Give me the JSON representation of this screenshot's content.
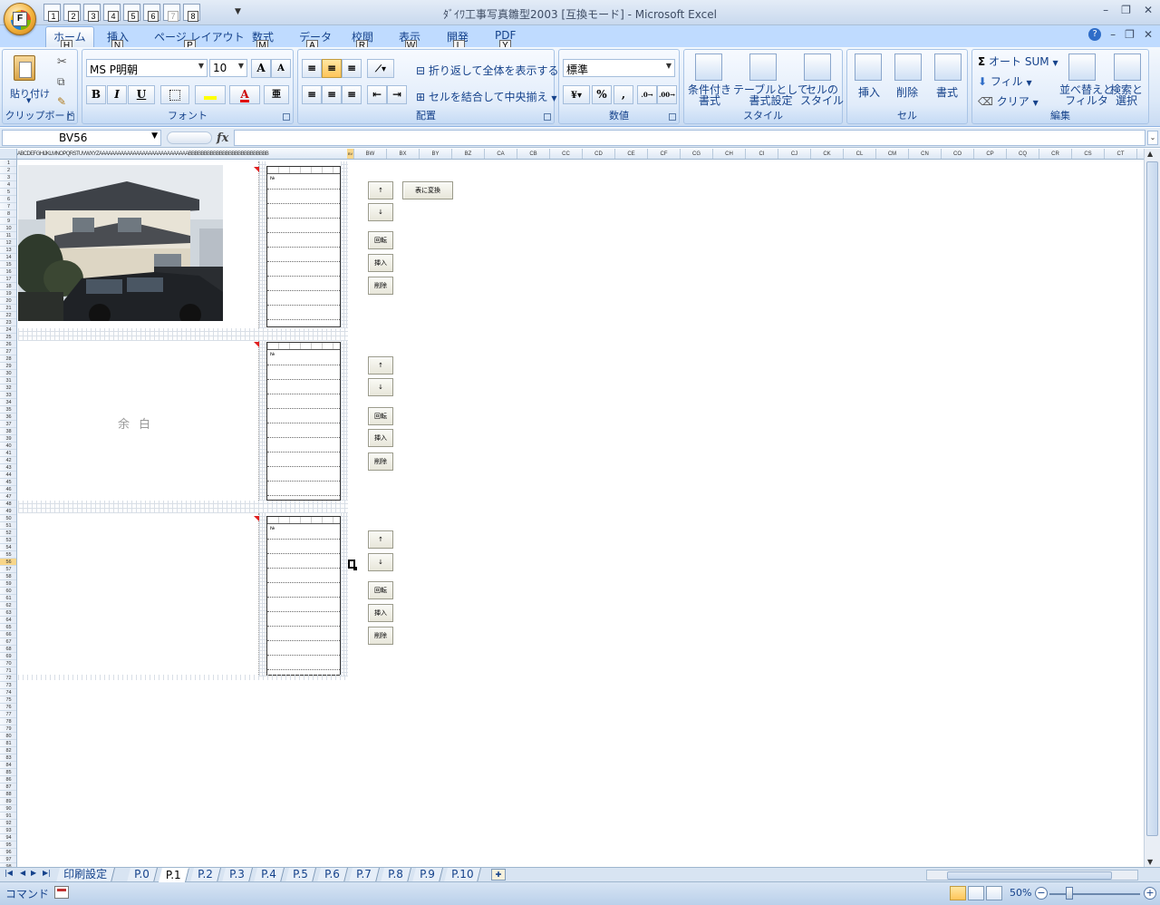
{
  "window": {
    "title": "ﾀﾞｲﾜ工事写真雛型2003 [互換モード] - Microsoft Excel",
    "office_key": "F",
    "qat_keys": [
      "1",
      "2",
      "3",
      "4",
      "5",
      "6",
      "7",
      "8"
    ],
    "controls": {
      "minimize": "–",
      "restore": "❐",
      "close": "✕"
    }
  },
  "ribbon_tabs": [
    {
      "label": "ホーム",
      "key": "H"
    },
    {
      "label": "挿入",
      "key": "N"
    },
    {
      "label": "ページ レイアウト",
      "key": "P"
    },
    {
      "label": "数式",
      "key": "M"
    },
    {
      "label": "データ",
      "key": "A"
    },
    {
      "label": "校閲",
      "key": "R"
    },
    {
      "label": "表示",
      "key": "W"
    },
    {
      "label": "開発",
      "key": "L"
    },
    {
      "label": "PDF",
      "key": "Y"
    }
  ],
  "clipboard": {
    "label": "クリップボード",
    "paste": "貼り付け"
  },
  "font": {
    "label": "フォント",
    "name": "MS P明朝",
    "size": "10",
    "bold": "B",
    "italic": "I",
    "underline": "U",
    "grow": "A",
    "shrink": "A"
  },
  "alignment": {
    "label": "配置",
    "wrap": "折り返して全体を表示する",
    "merge": "セルを結合して中央揃え"
  },
  "number": {
    "label": "数値",
    "format": "標準",
    "percent": "%",
    "comma": ","
  },
  "styles": {
    "label": "スタイル",
    "conditional": "条件付き\n書式",
    "table": "テーブルとして\n書式設定",
    "cell": "セルの\nスタイル"
  },
  "cells": {
    "label": "セル",
    "insert": "挿入",
    "delete": "削除",
    "format": "書式"
  },
  "editing": {
    "label": "編集",
    "autosum": "オート SUM",
    "fill": "フィル",
    "clear": "クリア",
    "sort": "並べ替えと\nフィルタ",
    "find": "検索と\n選択"
  },
  "formula_bar": {
    "name_box": "BV56",
    "fx": "fx",
    "value": ""
  },
  "columns": {
    "squeezed": "ABCDEFGHIJKLMNOPQRSTUVWXYZAAAAAAAAAAAAAAAAAAAAAAAAAAAAABBBBBBBBBBBBBBBBBBBBBBBBBB",
    "selected": "BV",
    "visible": [
      "BW",
      "BX",
      "BY",
      "BZ",
      "CA",
      "CB",
      "CC",
      "CD",
      "CE",
      "CF",
      "CG",
      "CH",
      "CI",
      "CJ",
      "CK",
      "CL",
      "CM",
      "CN",
      "CO",
      "CP",
      "CQ",
      "CR",
      "CS",
      "CT"
    ]
  },
  "rows": {
    "first": 1,
    "last": 98,
    "selected": 56
  },
  "sheet": {
    "blank_text": "余白",
    "note_label": "№",
    "convert_button": "表に変換",
    "side_buttons": [
      "↑",
      "↓",
      "回転",
      "挿入",
      "削除"
    ]
  },
  "sheet_tabs": [
    "印刷設定",
    "P.0",
    "P.1",
    "P.2",
    "P.3",
    "P.4",
    "P.5",
    "P.6",
    "P.7",
    "P.8",
    "P.9",
    "P.10"
  ],
  "active_sheet": "P.1",
  "status": {
    "mode": "コマンド",
    "zoom": "50%"
  }
}
